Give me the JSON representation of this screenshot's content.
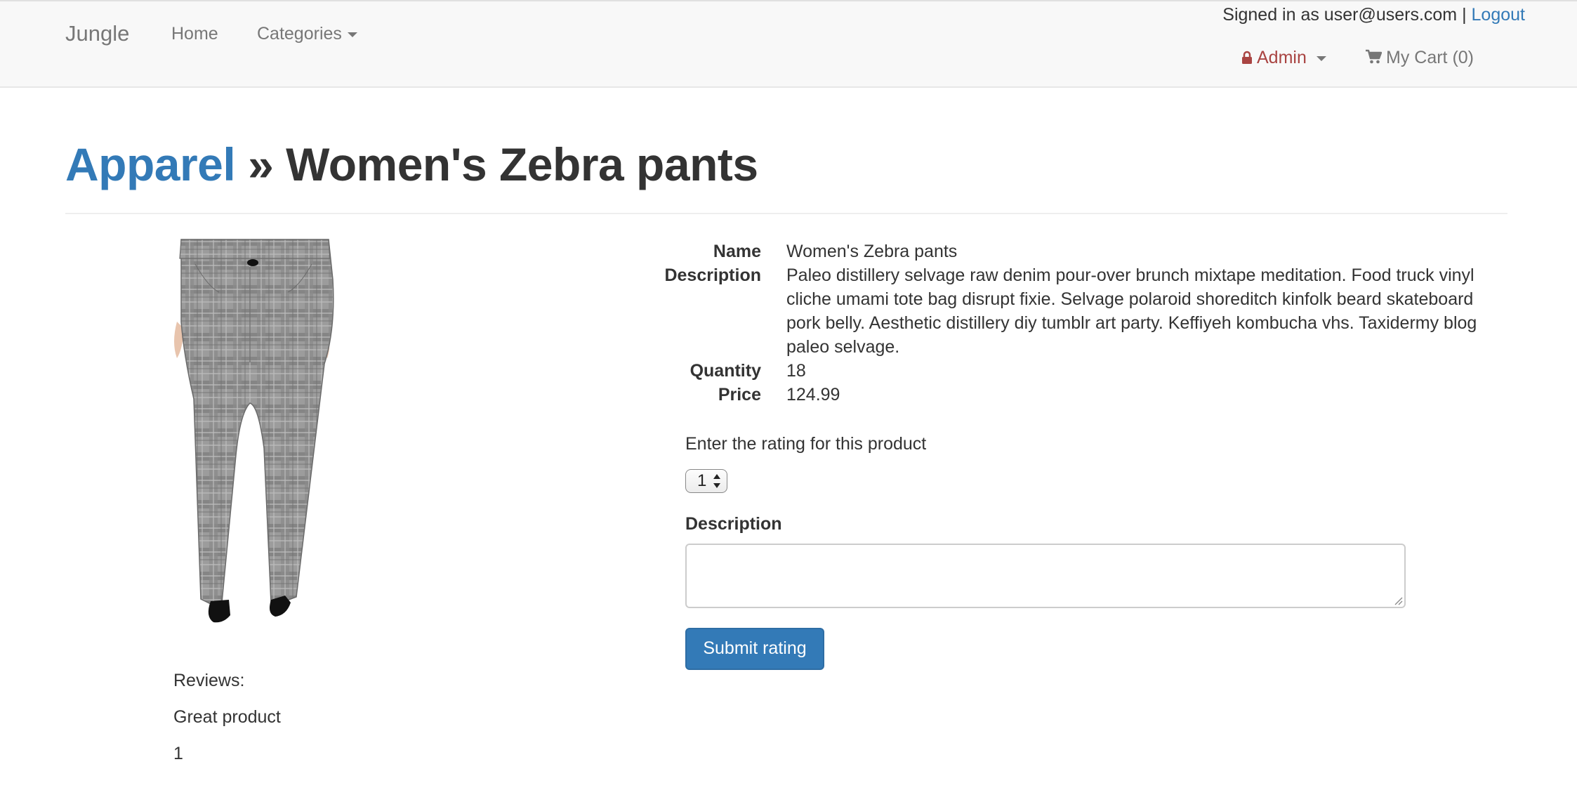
{
  "navbar": {
    "brand": "Jungle",
    "home": "Home",
    "categories": "Categories",
    "signed_in_text": "Signed in as user@users.com |",
    "logout": "Logout",
    "admin": "Admin",
    "cart": "My Cart (0)",
    "icons": {
      "admin": "lock-icon",
      "cart": "shopping-cart-icon",
      "dropdown": "caret-down-icon"
    }
  },
  "heading": {
    "category": "Apparel",
    "separator": " » ",
    "product": "Women's Zebra pants"
  },
  "product": {
    "image_alt": "Women's Zebra pants",
    "fields": [
      {
        "label": "Name",
        "value": "Women's Zebra pants"
      },
      {
        "label": "Description",
        "value": "Paleo distillery selvage raw denim pour-over brunch mixtape meditation. Food truck vinyl cliche umami tote bag disrupt fixie. Selvage polaroid shoreditch kinfolk beard skateboard pork belly. Aesthetic distillery diy tumblr art party. Keffiyeh kombucha vhs. Taxidermy blog paleo selvage."
      },
      {
        "label": "Quantity",
        "value": "18"
      },
      {
        "label": "Price",
        "value": "124.99"
      }
    ]
  },
  "rating_form": {
    "prompt": "Enter the rating for this product",
    "rating_value": "1",
    "description_label": "Description",
    "description_value": "",
    "submit": "Submit rating"
  },
  "reviews": {
    "heading": "Reviews:",
    "items": [
      {
        "text": "Great product",
        "rating": "1"
      }
    ]
  },
  "colors": {
    "link": "#337ab7",
    "admin": "#a94442",
    "navbar_bg": "#f8f8f8",
    "button": "#337ab7"
  }
}
